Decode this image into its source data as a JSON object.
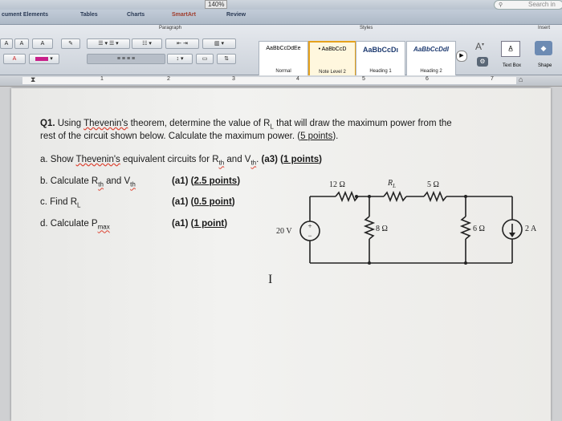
{
  "window": {
    "zoom": "140%",
    "search_placeholder": "Search in",
    "tabs": [
      "cument Elements",
      "Tables",
      "Charts",
      "SmartArt",
      "Review"
    ]
  },
  "ribbon": {
    "group_paragraph": "Paragraph",
    "group_styles": "Styles",
    "group_insert": "Insert",
    "font_grow": "A",
    "font_shrink": "A",
    "font_color": "A",
    "clear_format": "A",
    "styles": [
      {
        "preview": "AaBbCcDdEe",
        "name": "Normal"
      },
      {
        "preview": "• AaBbCcD",
        "name": "Note Level 2"
      },
      {
        "preview": "AaBbCcDı",
        "name": "Heading 1"
      },
      {
        "preview": "AaBbCcDdI",
        "name": "Heading 2"
      }
    ],
    "text_box": "Text Box",
    "shape": "Shape"
  },
  "ruler": {
    "marks": [
      "1",
      "2",
      "3",
      "4",
      "5",
      "6",
      "7"
    ]
  },
  "document": {
    "q1_prefix": "Q1.",
    "q1_line1_a": " Using ",
    "q1_thevenin": "Thevenin's",
    "q1_line1_b": " theorem, determine the value of R",
    "q1_sub_L": "L",
    "q1_line1_c": " that will draw the maximum power from the",
    "q1_line2_a": "rest of the circuit shown below. Calculate the maximum power. (",
    "q1_line2_pts": "5 points",
    "q1_line2_end": ").",
    "a_prefix": "a. Show ",
    "a_thevenins": "Thevenin's",
    "a_mid": " equivalent circuits for R",
    "a_th1": "th",
    "a_and": " and V",
    "a_th2": "th",
    "a_dot": ". ",
    "a_tag": "(a3)  (",
    "a_points": "1 points",
    "a_close": ")",
    "b_prefix": "b. Calculate R",
    "b_th1": "th",
    "b_and": " and V",
    "b_th2": "th",
    "b_tag": "(a1)",
    "b_open": "(",
    "b_points": "2.5 points",
    "b_close": ")",
    "c_prefix": "c. Find R",
    "c_sub": "L",
    "c_tag": "(a1)",
    "c_open": "(",
    "c_points": "0.5 point",
    "c_close": ")",
    "d_prefix": "d. Calculate P",
    "d_sub": "max",
    "d_tag": "(a1)",
    "d_open": "(",
    "d_points": "1 point",
    "d_close": ")"
  },
  "circuit": {
    "r1": "12 Ω",
    "rl_R": "R",
    "rl_L": "L",
    "r3": "5 Ω",
    "vsrc": "20 V",
    "r2": "8 Ω",
    "r4": "6 Ω",
    "isrc": "2 A"
  },
  "cursor_glyph": "I"
}
